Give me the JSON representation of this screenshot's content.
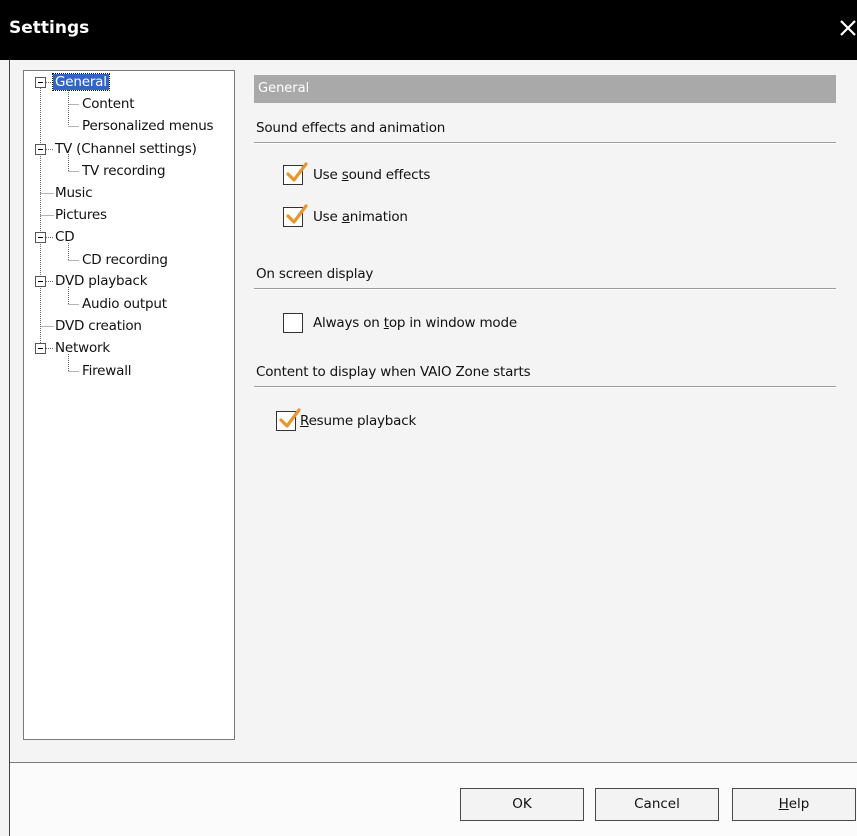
{
  "window": {
    "title": "Settings",
    "close_icon": "close-icon"
  },
  "tree": {
    "items": [
      {
        "label": "General",
        "level": 0,
        "expanded": true,
        "selected": true
      },
      {
        "label": "Content",
        "level": 1
      },
      {
        "label": "Personalized menus",
        "level": 1
      },
      {
        "label": "TV (Channel settings)",
        "level": 0,
        "expanded": true
      },
      {
        "label": "TV recording",
        "level": 1
      },
      {
        "label": "Music",
        "level": 0
      },
      {
        "label": "Pictures",
        "level": 0
      },
      {
        "label": "CD",
        "level": 0,
        "expanded": true
      },
      {
        "label": "CD recording",
        "level": 1
      },
      {
        "label": "DVD playback",
        "level": 0,
        "expanded": true
      },
      {
        "label": "Audio output",
        "level": 1
      },
      {
        "label": "DVD creation",
        "level": 0
      },
      {
        "label": "Network",
        "level": 0,
        "expanded": true
      },
      {
        "label": "Firewall",
        "level": 1
      }
    ]
  },
  "panel": {
    "header": "General",
    "groups": [
      {
        "label": "Sound effects and animation",
        "options": [
          {
            "pre": "Use ",
            "accel": "s",
            "post": "ound effects",
            "checked": true
          },
          {
            "pre": "Use ",
            "accel": "a",
            "post": "nimation",
            "checked": true
          }
        ]
      },
      {
        "label": "On screen display",
        "options": [
          {
            "pre": "Always on ",
            "accel": "t",
            "post": "op in window mode",
            "checked": false
          }
        ]
      },
      {
        "label": "Content to display when VAIO Zone starts",
        "options": [
          {
            "pre": "",
            "accel": "R",
            "post": "esume playback",
            "checked": true
          }
        ]
      }
    ]
  },
  "buttons": {
    "ok": "OK",
    "cancel": "Cancel",
    "help_accel": "H",
    "help_rest": "elp"
  },
  "colors": {
    "titlebar": "#000000",
    "selection": "#3166c6",
    "checkmark": "#e8962e",
    "header_bg": "#a9a9a9"
  }
}
